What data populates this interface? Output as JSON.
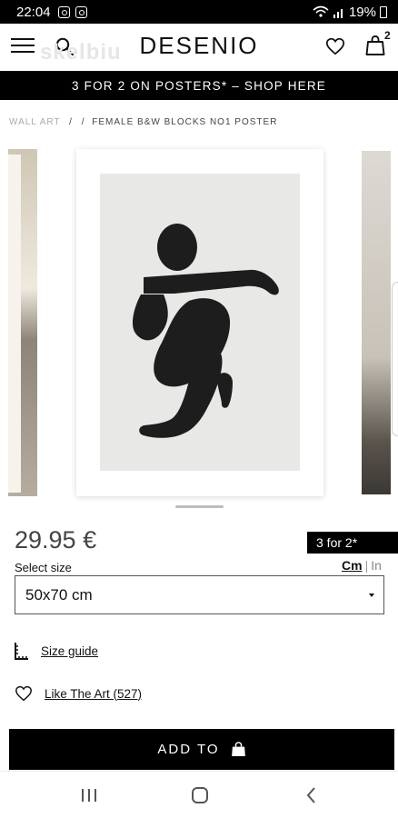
{
  "status_bar": {
    "time": "22:04",
    "battery": "19%"
  },
  "header": {
    "brand": "DESENIO",
    "watermark": "skelbiu",
    "cart_count": "2"
  },
  "promo": {
    "text": "3 FOR 2 ON POSTERS* – SHOP HERE"
  },
  "breadcrumb": {
    "root": "WALL ART",
    "sep1": "/",
    "sep2": "/",
    "current": "FEMALE B&W BLOCKS NO1 POSTER"
  },
  "product": {
    "price": "29.95 €",
    "offer_badge": "3 for 2*",
    "size_label": "Select size",
    "unit_cm": "Cm",
    "unit_sep": "|",
    "unit_in": "In",
    "selected_size": "50x70 cm",
    "size_guide": "Size guide",
    "like_text": "Like The Art (527)"
  },
  "cta": {
    "add_label": "ADD TO"
  },
  "icons": [
    "menu-icon",
    "search-icon",
    "heart-icon",
    "bag-icon",
    "ruler-icon",
    "chevron-down-icon",
    "recent-apps-icon",
    "home-icon",
    "back-icon"
  ],
  "colors": {
    "accent": "#000000",
    "text": "#111111",
    "price": "#444444"
  }
}
